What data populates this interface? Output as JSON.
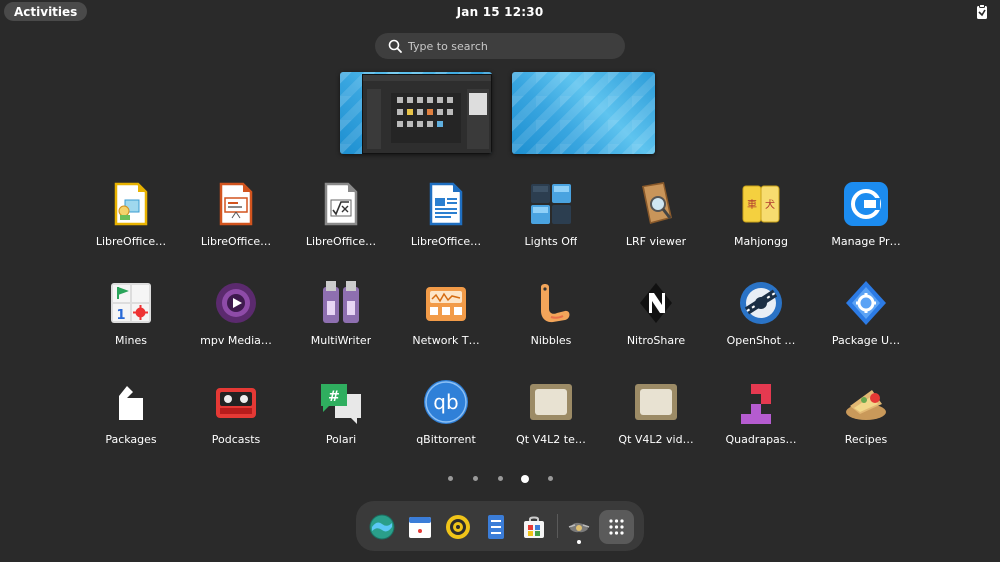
{
  "topbar": {
    "activities": "Activities",
    "clock": "Jan 15  12:30"
  },
  "search": {
    "placeholder": "Type to search"
  },
  "apps": [
    {
      "label": "LibreOffice…",
      "icon": "libreoffice-draw-icon"
    },
    {
      "label": "LibreOffice…",
      "icon": "libreoffice-impress-icon"
    },
    {
      "label": "LibreOffice…",
      "icon": "libreoffice-math-icon"
    },
    {
      "label": "LibreOffice…",
      "icon": "libreoffice-writer-icon"
    },
    {
      "label": "Lights Off",
      "icon": "lights-off-icon"
    },
    {
      "label": "LRF viewer",
      "icon": "lrf-viewer-icon"
    },
    {
      "label": "Mahjongg",
      "icon": "mahjongg-icon"
    },
    {
      "label": "Manage Pr…",
      "icon": "manage-printing-icon"
    },
    {
      "label": "Mines",
      "icon": "mines-icon"
    },
    {
      "label": "mpv Media…",
      "icon": "mpv-icon"
    },
    {
      "label": "MultiWriter",
      "icon": "multiwriter-icon"
    },
    {
      "label": "Network T…",
      "icon": "network-tools-icon"
    },
    {
      "label": "Nibbles",
      "icon": "nibbles-icon"
    },
    {
      "label": "NitroShare",
      "icon": "nitroshare-icon"
    },
    {
      "label": "OpenShot …",
      "icon": "openshot-icon"
    },
    {
      "label": "Package U…",
      "icon": "package-updater-icon"
    },
    {
      "label": "Packages",
      "icon": "packages-icon"
    },
    {
      "label": "Podcasts",
      "icon": "podcasts-icon"
    },
    {
      "label": "Polari",
      "icon": "polari-icon"
    },
    {
      "label": "qBittorrent",
      "icon": "qbittorrent-icon"
    },
    {
      "label": "Qt V4L2 te…",
      "icon": "qv4l2-test-icon"
    },
    {
      "label": "Qt V4L2 vid…",
      "icon": "qv4l2-video-icon"
    },
    {
      "label": "Quadrapas…",
      "icon": "quadrapassel-icon"
    },
    {
      "label": "Recipes",
      "icon": "recipes-icon"
    }
  ],
  "pages": {
    "count": 5,
    "active_index": 3
  },
  "dash": [
    {
      "name": "browser-icon"
    },
    {
      "name": "calendar-icon"
    },
    {
      "name": "music-icon"
    },
    {
      "name": "files-icon"
    },
    {
      "name": "software-icon"
    },
    {
      "name": "settings-app-icon"
    },
    {
      "name": "show-apps-icon"
    }
  ]
}
